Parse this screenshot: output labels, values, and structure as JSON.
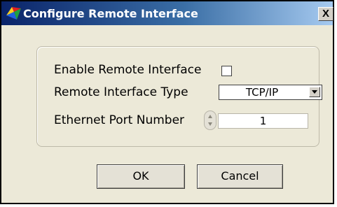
{
  "window": {
    "title": "Configure Remote Interface",
    "close_label": "X"
  },
  "form": {
    "enable_label": "Enable Remote Interface",
    "enable_checked": false,
    "type_label": "Remote Interface Type",
    "type_value": "TCP/IP",
    "port_label": "Ethernet Port Number",
    "port_value": "1"
  },
  "buttons": {
    "ok_label": "OK",
    "cancel_label": "Cancel"
  },
  "icons": {
    "app": "labview-app-icon",
    "close": "close-icon",
    "dropdown": "dropdown-arrow-icon",
    "spinner": "increment-decrement-icon"
  },
  "colors": {
    "titlebar_start": "#0a246a",
    "titlebar_end": "#a6caf0",
    "dialog_background": "#ece9d8"
  }
}
